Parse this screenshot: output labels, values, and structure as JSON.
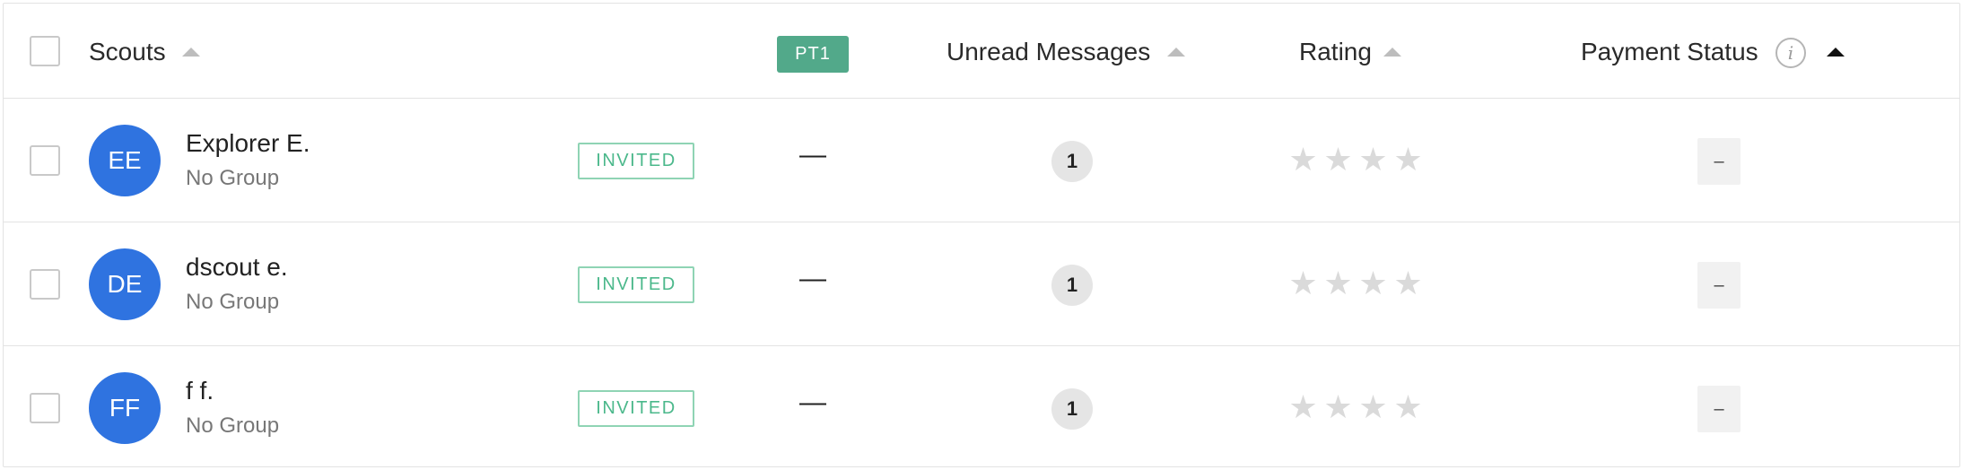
{
  "header": {
    "scouts_label": "Scouts",
    "pt_badge": "PT1",
    "unread_label": "Unread Messages",
    "rating_label": "Rating",
    "payment_label": "Payment Status",
    "info_glyph": "i"
  },
  "rows": [
    {
      "initials": "EE",
      "name": "Explorer E.",
      "group": "No Group",
      "status": "INVITED",
      "pt_value": "—",
      "unread": "1",
      "rating": 0,
      "payment": "–"
    },
    {
      "initials": "DE",
      "name": "dscout e.",
      "group": "No Group",
      "status": "INVITED",
      "pt_value": "—",
      "unread": "1",
      "rating": 0,
      "payment": "–"
    },
    {
      "initials": "FF",
      "name": "f f.",
      "group": "No Group",
      "status": "INVITED",
      "pt_value": "—",
      "unread": "1",
      "rating": 0,
      "payment": "–"
    }
  ],
  "colors": {
    "avatar": "#2f73e0",
    "pt_badge": "#52a98a",
    "invited_border": "#8fd4b4",
    "invited_text": "#4bb88b",
    "star_empty": "#dadada"
  },
  "icons": {
    "star": "★",
    "sort": "sort-ascending-icon",
    "info": "info-icon"
  }
}
